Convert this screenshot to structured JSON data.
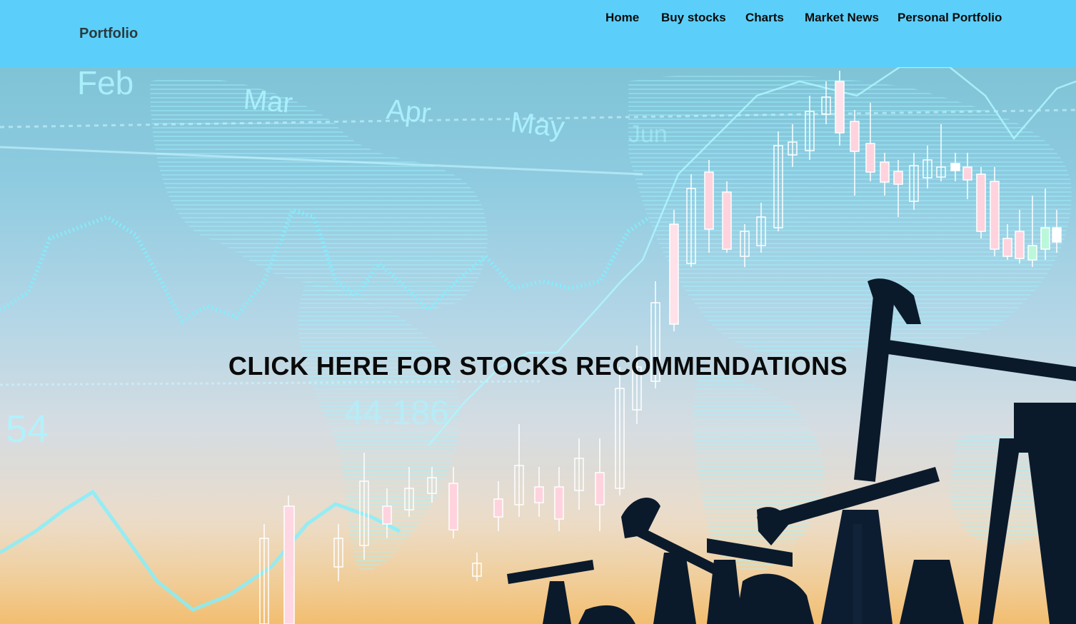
{
  "navbar": {
    "brand": "Portfolio",
    "links": [
      {
        "label": "Home"
      },
      {
        "label": "Buy stocks"
      },
      {
        "label": "Charts"
      },
      {
        "label": "Market News"
      },
      {
        "label": "Personal Portfolio"
      }
    ],
    "background_color": "#5bcffa"
  },
  "hero": {
    "cta_label": "CLICK HERE FOR STOCKS RECOMMENDATIONS",
    "overlay_texts": {
      "month_feb": "Feb",
      "month_mar": "Mar",
      "month_apr": "Apr",
      "month_may": "May",
      "month_jun": "Jun",
      "value_54": "54",
      "value_44186": "44.186"
    },
    "accent_color": "#7ff0ff"
  }
}
